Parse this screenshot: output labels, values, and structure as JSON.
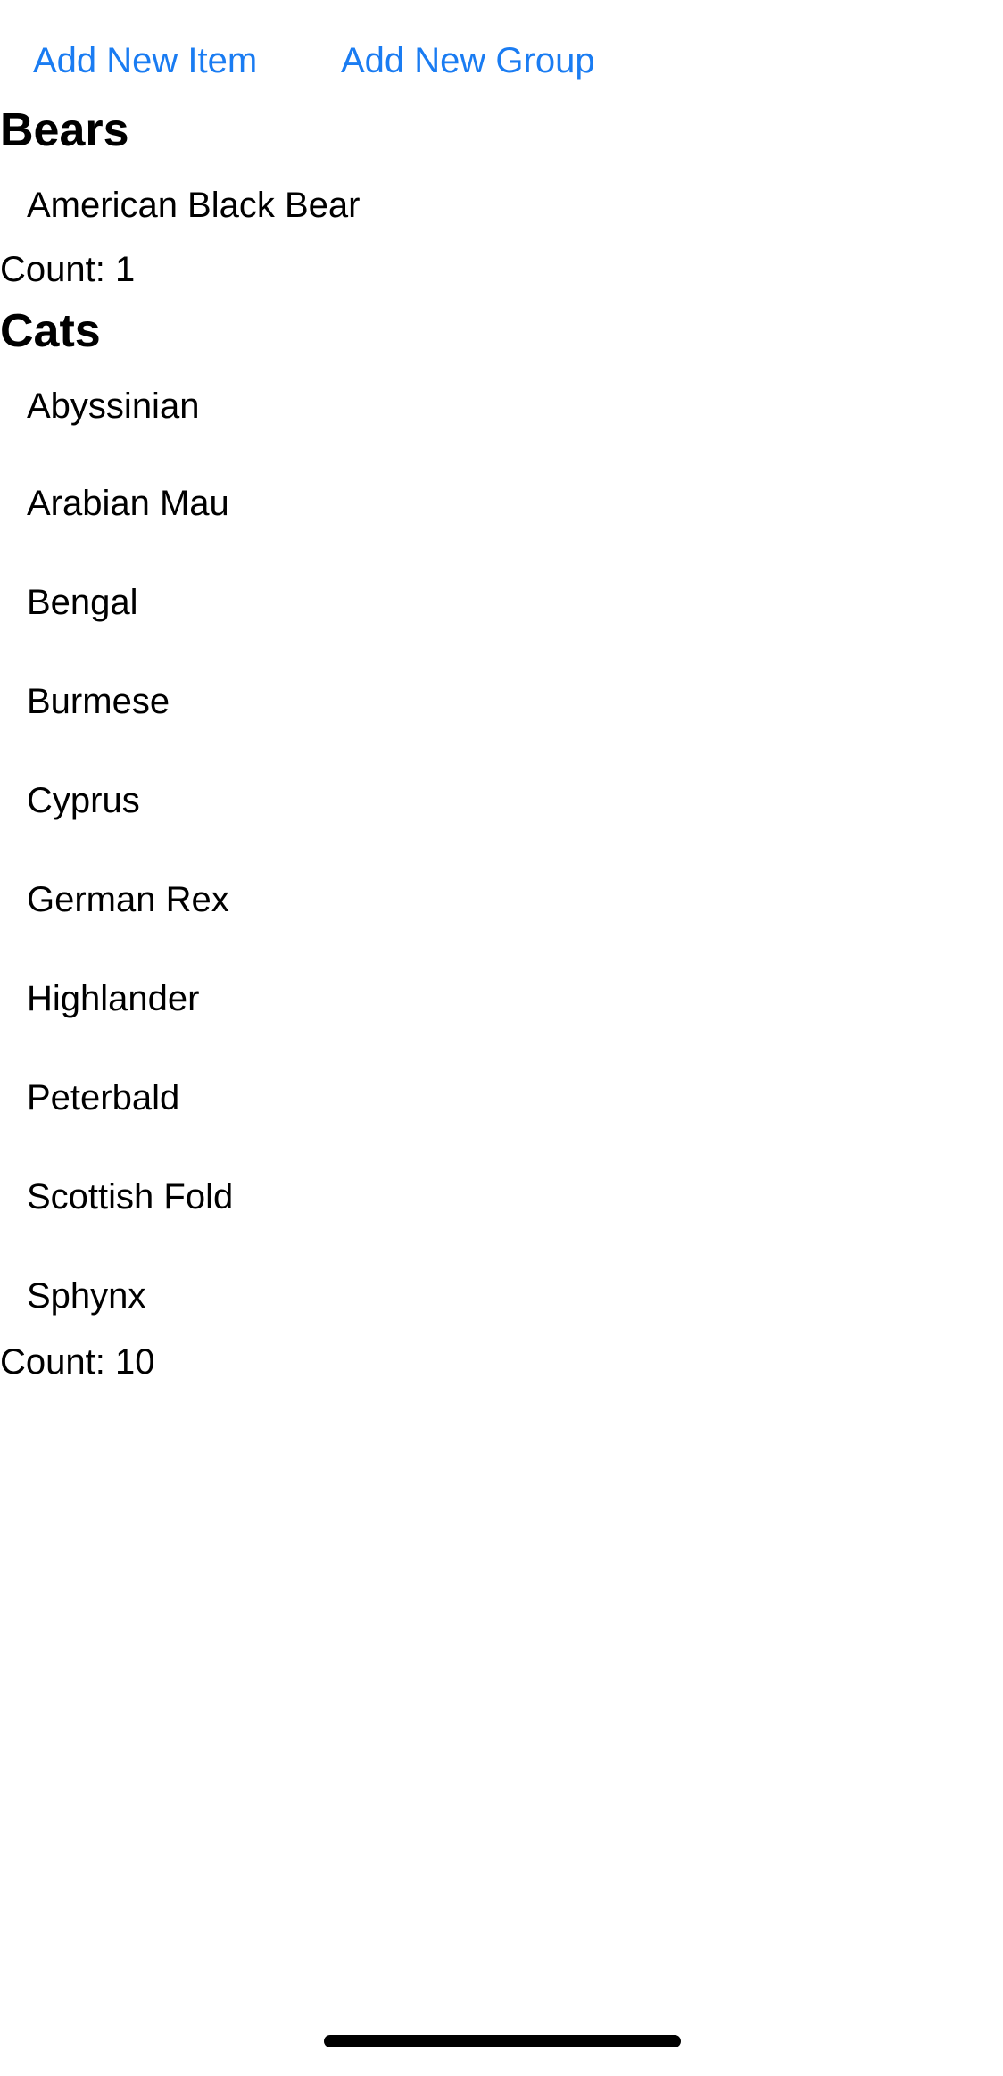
{
  "toolbar": {
    "add_item_label": "Add New Item",
    "add_group_label": "Add New Group"
  },
  "groups": [
    {
      "title": "Bears",
      "items": [
        "American Black Bear"
      ],
      "count_label": "Count: 1"
    },
    {
      "title": "Cats",
      "items": [
        "Abyssinian",
        "Arabian Mau",
        "Bengal",
        "Burmese",
        "Cyprus",
        "German Rex",
        "Highlander",
        "Peterbald",
        "Scottish Fold",
        "Sphynx"
      ],
      "count_label": "Count: 10"
    }
  ],
  "colors": {
    "accent": "#1a7cf2",
    "text": "#000000",
    "background": "#ffffff"
  }
}
